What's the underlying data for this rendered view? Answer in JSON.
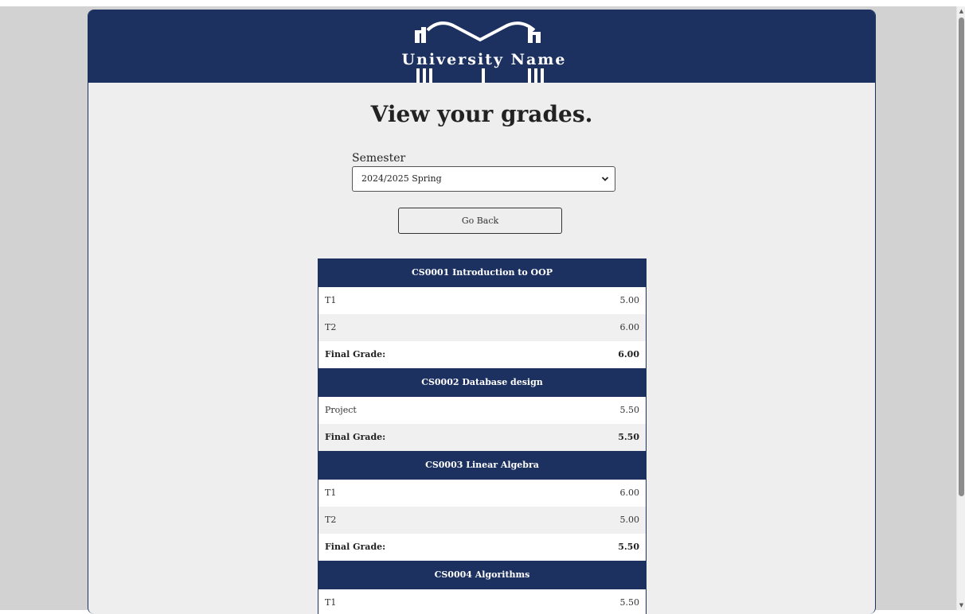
{
  "university": {
    "name": "University Name"
  },
  "page": {
    "title": "View your grades."
  },
  "semester": {
    "label": "Semester",
    "selected": "2024/2025 Spring"
  },
  "buttons": {
    "go_back": "Go Back"
  },
  "courses": [
    {
      "title": "CS0001 Introduction to OOP",
      "rows": [
        {
          "label": "T1",
          "value": "5.00"
        },
        {
          "label": "T2",
          "value": "6.00"
        },
        {
          "label": "Final Grade:",
          "value": "6.00"
        }
      ]
    },
    {
      "title": "CS0002 Database design",
      "rows": [
        {
          "label": "Project",
          "value": "5.50"
        },
        {
          "label": "Final Grade:",
          "value": "5.50"
        }
      ]
    },
    {
      "title": "CS0003 Linear Algebra",
      "rows": [
        {
          "label": "T1",
          "value": "6.00"
        },
        {
          "label": "T2",
          "value": "5.00"
        },
        {
          "label": "Final Grade:",
          "value": "5.50"
        }
      ]
    },
    {
      "title": "CS0004 Algorithms",
      "rows": [
        {
          "label": "T1",
          "value": "5.50"
        }
      ]
    }
  ],
  "colors": {
    "brand_navy": "#1c3160",
    "page_background": "#eeeeee",
    "outer_background": "#d2d2d2"
  },
  "icons": {
    "logo": "university-logo-icon",
    "select_arrow": "chevron-down-icon"
  }
}
